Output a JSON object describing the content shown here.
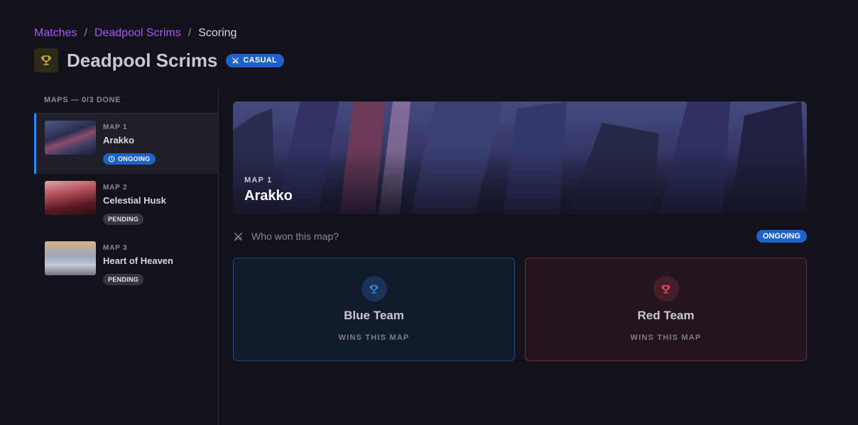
{
  "breadcrumb": {
    "matches": "Matches",
    "scrims": "Deadpool Scrims",
    "current": "Scoring",
    "separator": "/"
  },
  "header": {
    "title": "Deadpool Scrims",
    "badge": "CASUAL"
  },
  "sidebar": {
    "heading": "MAPS — 0/3 DONE",
    "maps": [
      {
        "number": "MAP 1",
        "name": "Arakko",
        "status": "ONGOING"
      },
      {
        "number": "MAP 2",
        "name": "Celestial Husk",
        "status": "PENDING"
      },
      {
        "number": "MAP 3",
        "name": "Heart of Heaven",
        "status": "PENDING"
      }
    ]
  },
  "hero": {
    "number": "MAP 1",
    "name": "Arakko"
  },
  "question": {
    "text": "Who won this map?",
    "status": "ONGOING"
  },
  "teams": {
    "blue": {
      "name": "Blue Team",
      "subtitle": "WINS THIS MAP"
    },
    "red": {
      "name": "Red Team",
      "subtitle": "WINS THIS MAP"
    }
  },
  "colors": {
    "accent_purple": "#a855f7",
    "accent_blue": "#1e62c9",
    "blue_team": "#3b8ef0",
    "red_team": "#f0505f",
    "trophy_gold": "#e0b83a"
  },
  "icons": {
    "title": "trophy-icon",
    "casual": "swords-icon",
    "ongoing": "clock-icon",
    "question": "swords-icon",
    "team": "trophy-icon"
  }
}
